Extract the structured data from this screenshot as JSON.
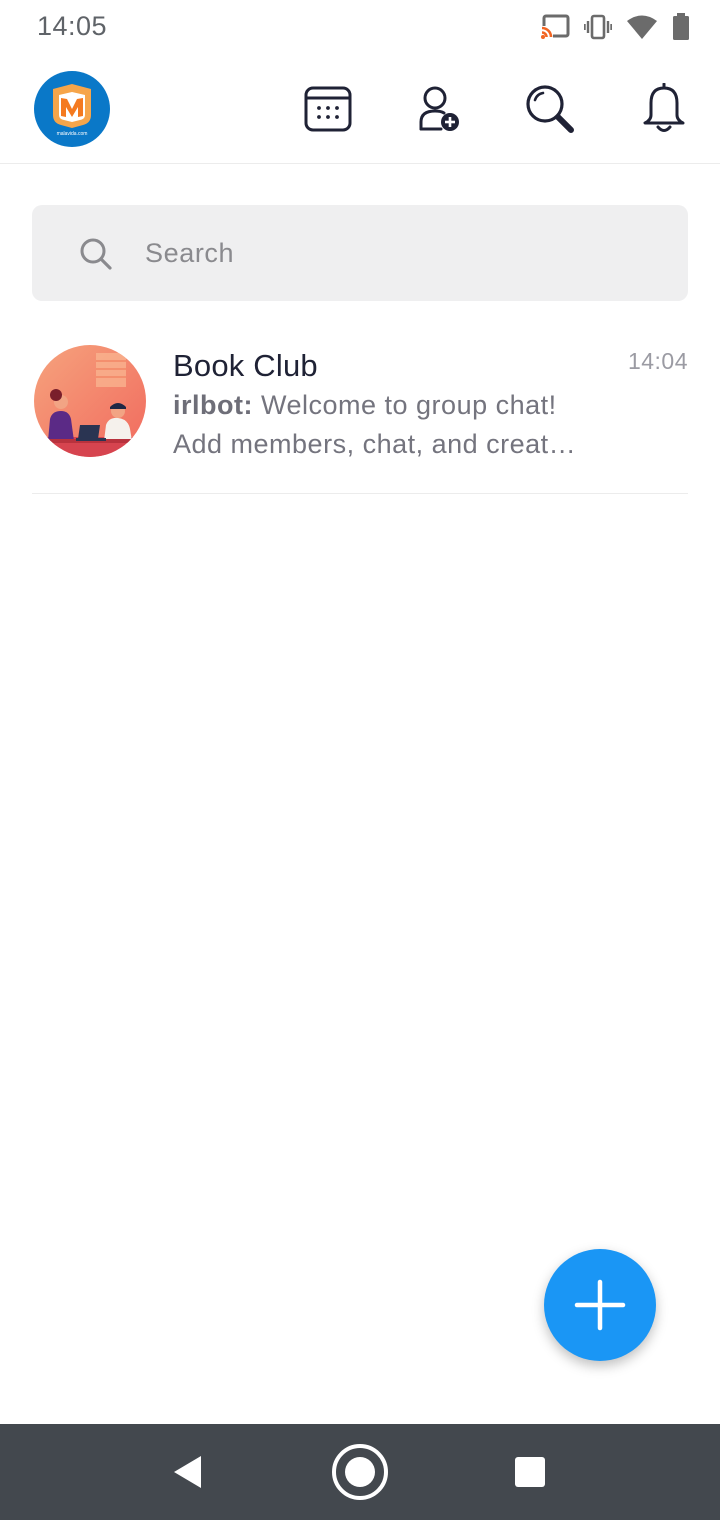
{
  "status_bar": {
    "time": "14:05",
    "icons": [
      "cast-icon",
      "vibrate-icon",
      "wifi-icon",
      "battery-icon"
    ]
  },
  "header": {
    "profile_logo_text": "malavida.com",
    "actions": [
      {
        "name": "calendar-icon"
      },
      {
        "name": "add-contact-icon"
      },
      {
        "name": "search-icon"
      },
      {
        "name": "bell-icon"
      }
    ]
  },
  "search": {
    "placeholder": "Search"
  },
  "conversations": [
    {
      "title": "Book Club",
      "time": "14:04",
      "sender": "irlbot:",
      "message_line1": " Welcome to group chat!",
      "message_line2": "Add members, chat, and creat…"
    }
  ],
  "fab": {
    "icon": "plus-icon"
  },
  "nav_bar": {
    "icons": [
      "back-icon",
      "home-icon",
      "recents-icon"
    ]
  },
  "colors": {
    "accent": "#1a96f5",
    "logo_blue": "#0a78c8",
    "logo_orange": "#f47a20",
    "nav_bar": "#43484e",
    "title_text": "#1f2235",
    "secondary_text": "#74747e"
  }
}
